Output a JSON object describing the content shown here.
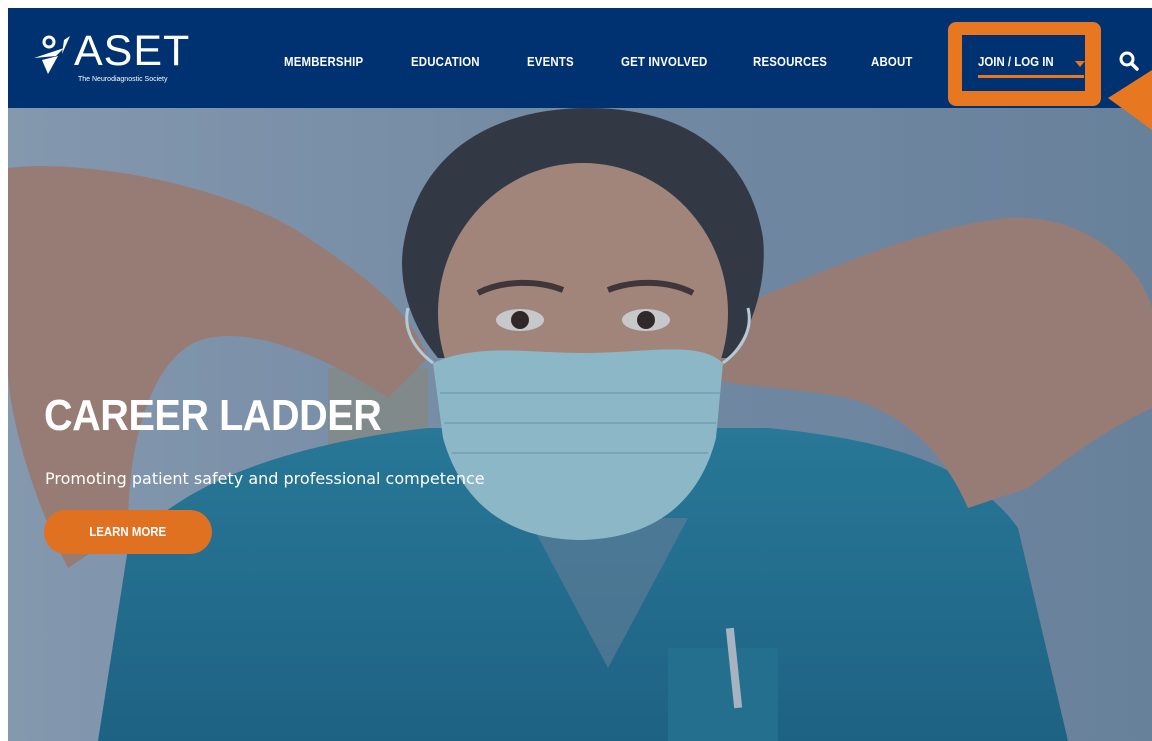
{
  "logo": {
    "wordmark": "ASET",
    "tagline": "The Neurodiagnostic Society"
  },
  "nav": {
    "items": [
      {
        "label": "MEMBERSHIP"
      },
      {
        "label": "EDUCATION"
      },
      {
        "label": "EVENTS"
      },
      {
        "label": "GET INVOLVED"
      },
      {
        "label": "RESOURCES"
      },
      {
        "label": "ABOUT"
      }
    ],
    "join_label": "JOIN / LOG IN"
  },
  "hero": {
    "title": "CAREER LADDER",
    "subtitle": "Promoting patient safety and professional competence",
    "cta_label": "LEARN MORE"
  },
  "icons": {
    "logo_mark": "aset-figure-icon",
    "search": "search-icon",
    "join_dropdown": "caret-down-icon",
    "annotation": "pointer-arrow-icon"
  },
  "colors": {
    "header_bg": "#003271",
    "accent": "#e87722",
    "hero_tint": "#8ea3b7",
    "text": "#ffffff"
  }
}
